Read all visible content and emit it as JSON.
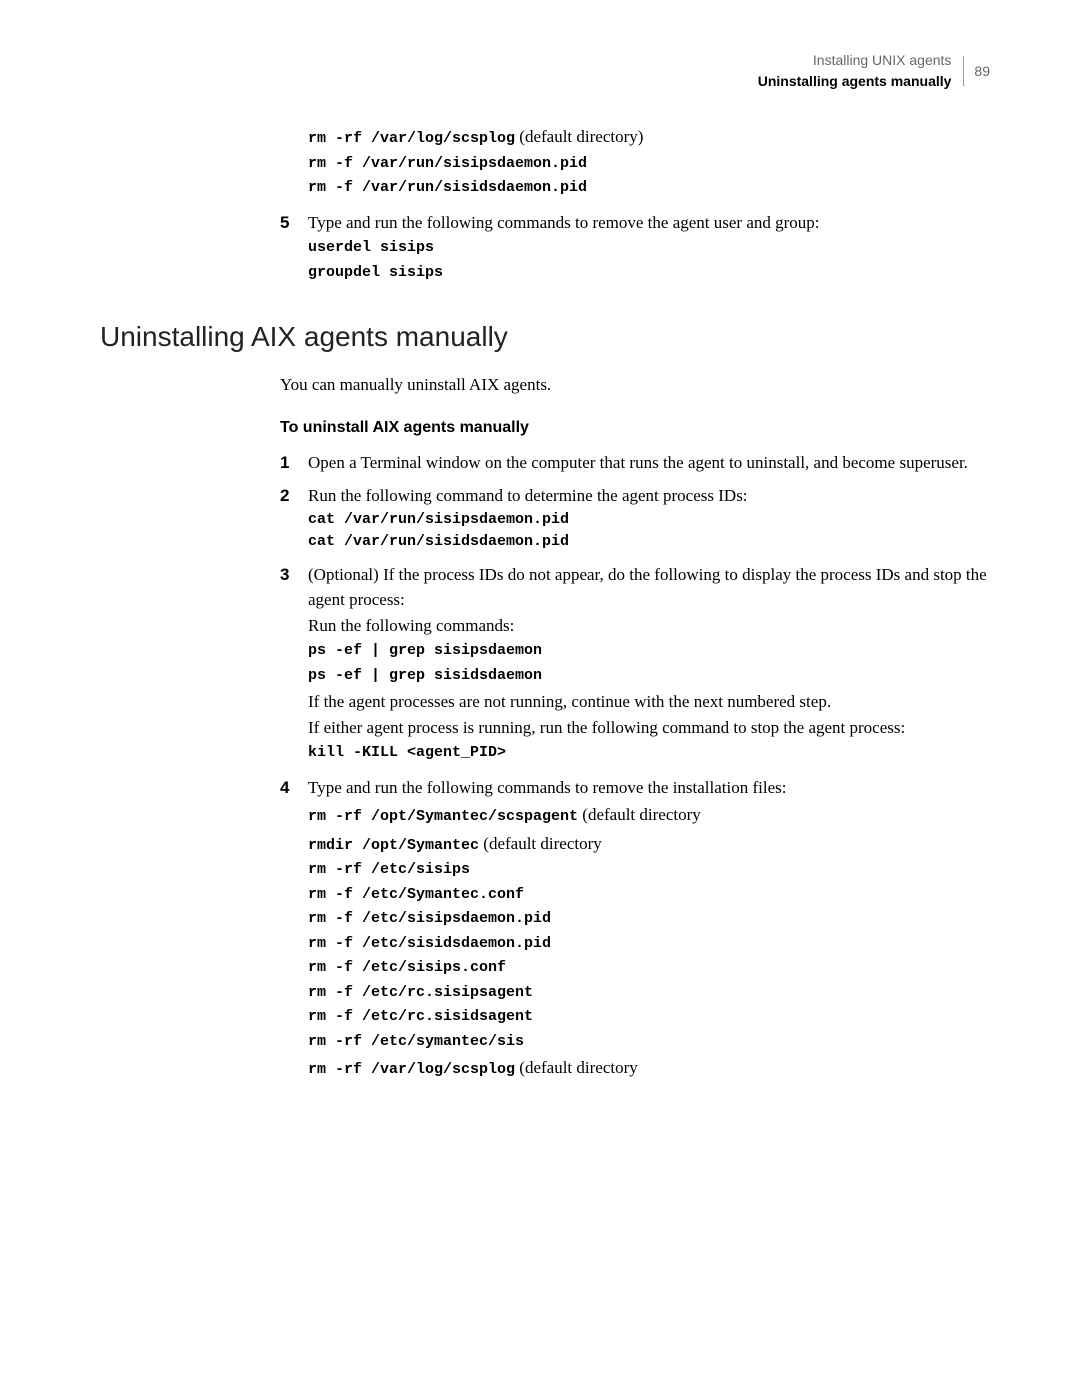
{
  "header": {
    "title": "Installing UNIX agents",
    "subtitle": "Uninstalling agents manually",
    "page_num": "89"
  },
  "top_block": {
    "cmd1": "rm -rf /var/log/scsplog",
    "cmd1_note": " (default directory)",
    "cmd2": "rm -f /var/run/sisipsdaemon.pid",
    "cmd3": "rm -f /var/run/sisidsdaemon.pid"
  },
  "step5": {
    "num": "5",
    "text": "Type and run the following commands to remove the agent user and group:",
    "cmd1": "userdel sisips",
    "cmd2": "groupdel sisips"
  },
  "h2": "Uninstalling AIX agents manually",
  "intro": "You can manually uninstall AIX agents.",
  "subhead": "To uninstall AIX agents manually",
  "step1": {
    "num": "1",
    "text": "Open a Terminal window on the computer that runs the agent to uninstall, and become superuser."
  },
  "step2": {
    "num": "2",
    "text": "Run the following command to determine the agent process IDs:",
    "cmd1": "cat /var/run/sisipsdaemon.pid",
    "cmd2": "cat /var/run/sisidsdaemon.pid"
  },
  "step3": {
    "num": "3",
    "text": "(Optional) If the process IDs do not appear, do the following to display the process IDs and stop the agent process:",
    "line2": "Run the following commands:",
    "cmd1": "ps -ef | grep sisipsdaemon",
    "cmd2": "ps -ef | grep sisidsdaemon",
    "line3": "If the agent processes are not running, continue with the next numbered step.",
    "line4": "If either agent process is running, run the following command to stop the agent process:",
    "cmd3": "kill -KILL <agent_PID>"
  },
  "step4": {
    "num": "4",
    "text": "Type and run the following commands to remove the installation files:",
    "cmd1": "rm -rf /opt/Symantec/scspagent",
    "cmd1_note": " (default directory",
    "cmd2": "rmdir /opt/Symantec",
    "cmd2_note": " (default directory",
    "cmd3": "rm -rf /etc/sisips",
    "cmd4": "rm -f /etc/Symantec.conf",
    "cmd5": "rm -f /etc/sisipsdaemon.pid",
    "cmd6": "rm -f /etc/sisidsdaemon.pid",
    "cmd7": "rm -f /etc/sisips.conf",
    "cmd8": "rm -f /etc/rc.sisipsagent",
    "cmd9": "rm -f /etc/rc.sisidsagent",
    "cmd10": "rm -rf /etc/symantec/sis",
    "cmd11": "rm -rf /var/log/scsplog",
    "cmd11_note": " (default directory"
  }
}
